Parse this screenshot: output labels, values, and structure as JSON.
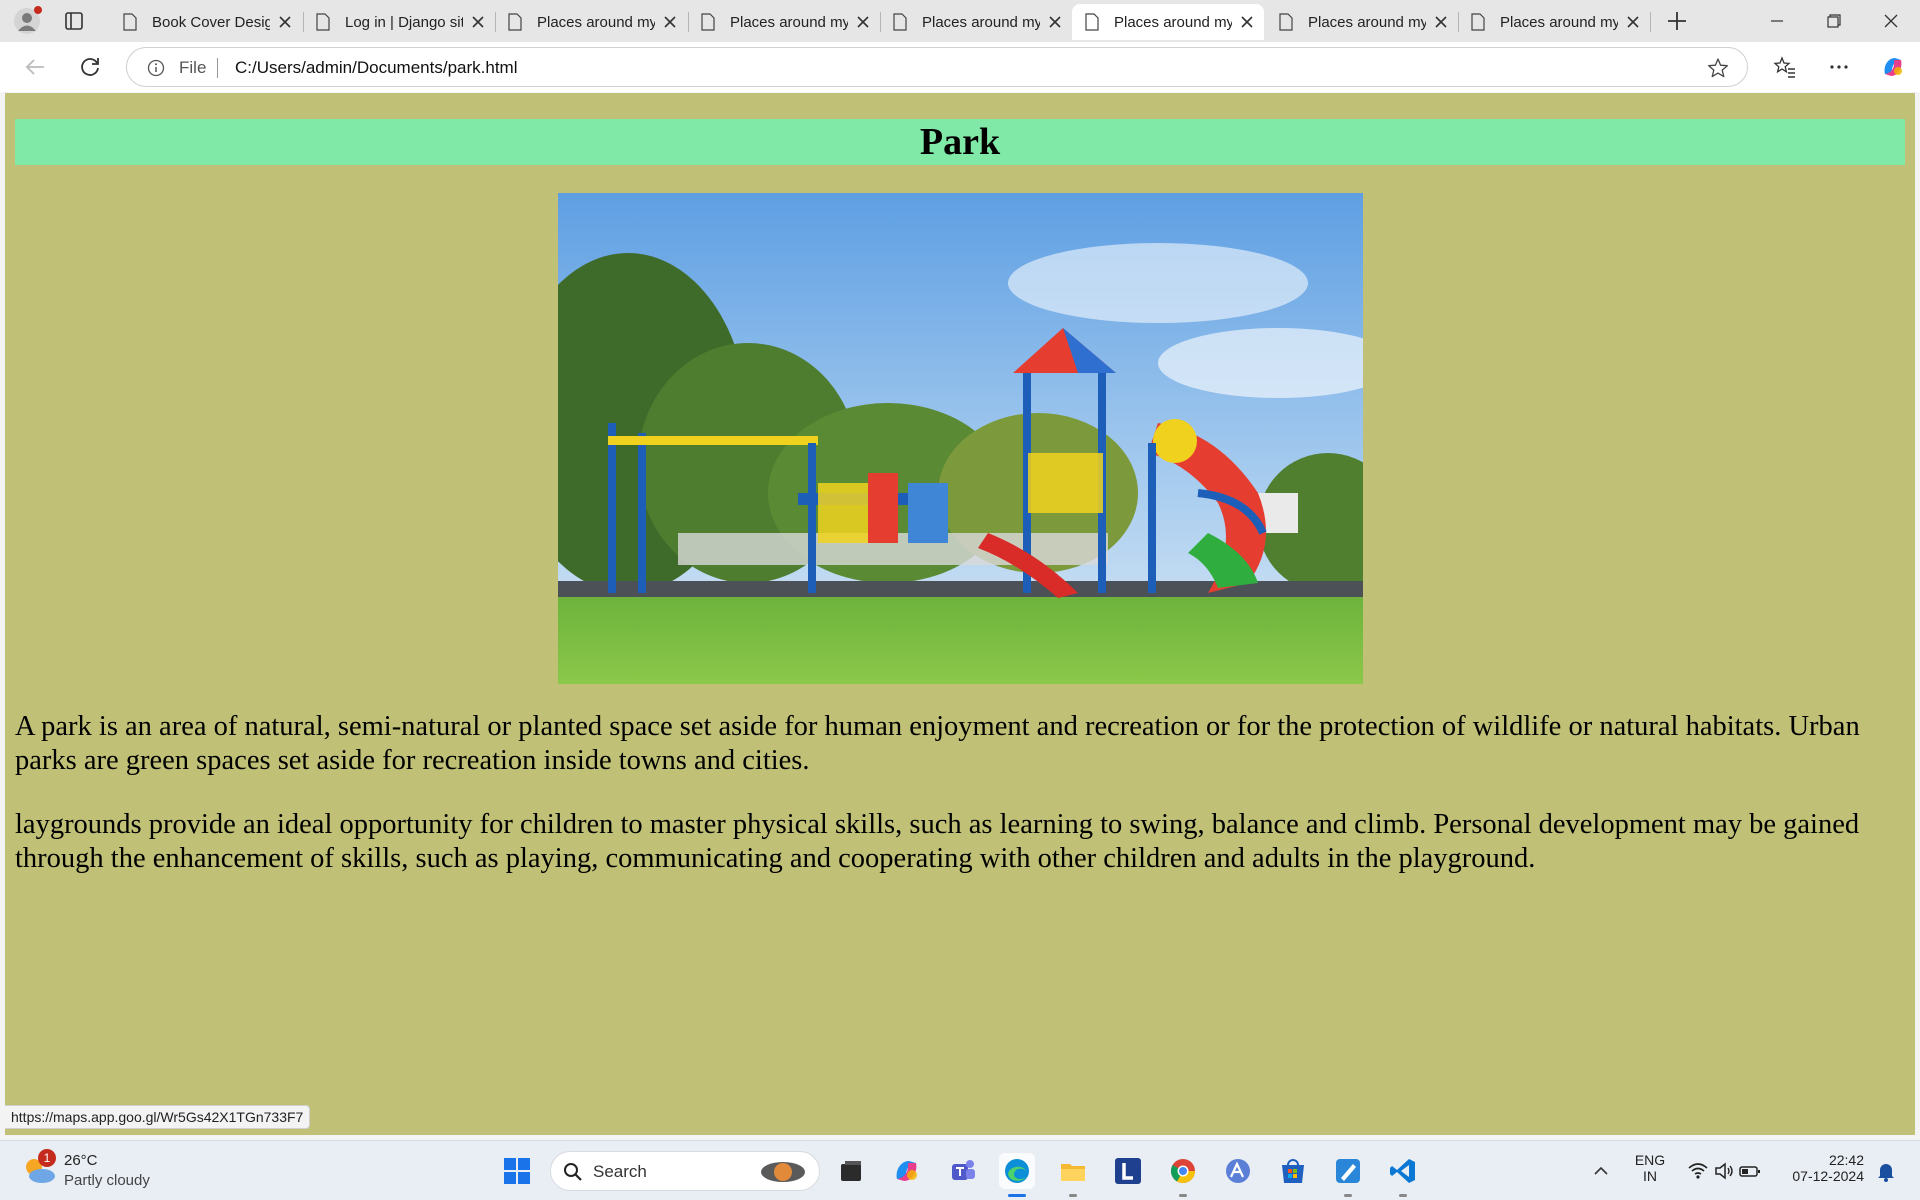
{
  "browser": {
    "tabs": [
      {
        "title": "Book Cover Design",
        "active": false
      },
      {
        "title": "Log in | Django site admin",
        "active": false
      },
      {
        "title": "Places around my city",
        "active": false
      },
      {
        "title": "Places around my city",
        "active": false
      },
      {
        "title": "Places around my city",
        "active": false
      },
      {
        "title": "Places around my city",
        "active": true
      },
      {
        "title": "Places around my city",
        "active": false
      },
      {
        "title": "Places around my city",
        "active": false
      }
    ],
    "address_bar": {
      "scheme_label": "File",
      "url": "C:/Users/admin/Documents/park.html"
    },
    "status_url": "https://maps.app.goo.gl/Wr5Gs42X1TGn733F7"
  },
  "page": {
    "heading": "Park",
    "paragraphs": [
      "A park is an area of natural, semi-natural or planted space set aside for human enjoyment and recreation or for the protection of wildlife or natural habitats. Urban parks are green spaces set aside for recreation inside towns and cities.",
      "laygrounds provide an ideal opportunity for children to master physical skills, such as learning to swing, balance and climb. Personal development may be gained through the enhancement of skills, such as playing, communicating and cooperating with other children and adults in the playground."
    ],
    "colors": {
      "background": "#c0c176",
      "heading_bar": "#80e9a8"
    }
  },
  "taskbar": {
    "weather": {
      "temp": "26°C",
      "desc": "Partly cloudy",
      "badge": "1"
    },
    "search_label": "Search",
    "apps": [
      "start-icon",
      "search",
      "file-manager-icon",
      "copilot-icon",
      "teams-icon",
      "edge-icon",
      "file-explorer-icon",
      "l-app-icon",
      "chrome-icon",
      "arc-icon",
      "store-icon",
      "paint-icon",
      "vscode-icon"
    ],
    "tray": {
      "lang_top": "ENG",
      "lang_bottom": "IN",
      "time": "22:42",
      "date": "07-12-2024"
    }
  }
}
